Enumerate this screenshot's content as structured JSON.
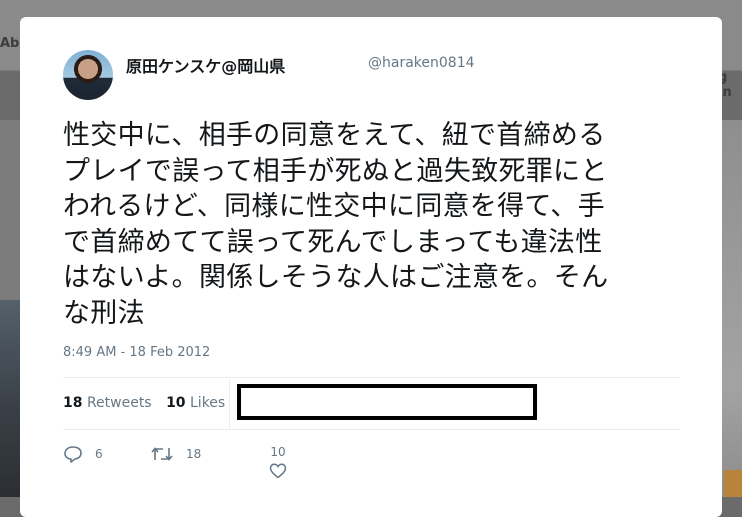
{
  "background": {
    "nav_left_text": "Abo",
    "nav_right_text": "g in"
  },
  "tweet": {
    "display_name": "原田ケンスケ@岡山県",
    "handle": "@haraken0814",
    "text_lines": [
      "性交中に、相手の同意をえて、紐で首締める",
      "プレイで誤って相手が死ぬと過失致死罪にと",
      "われるけど、同様に性交中に同意を得て、手",
      "で首締めてて誤って死んでしまっても違法性",
      "はないよ。関係しそうな人はご注意を。そん",
      "な刑法"
    ],
    "timestamp": "8:49 AM - 18 Feb 2012",
    "retweets_count": "18",
    "retweets_label": "Retweets",
    "likes_count": "10",
    "likes_label": "Likes",
    "actions": {
      "reply_count": "6",
      "retweet_count": "18",
      "like_count": "10"
    }
  },
  "colors": {
    "text": "#14171a",
    "muted": "#657786",
    "divider": "#e6ecf0",
    "overlay": "#6b6b6b"
  }
}
